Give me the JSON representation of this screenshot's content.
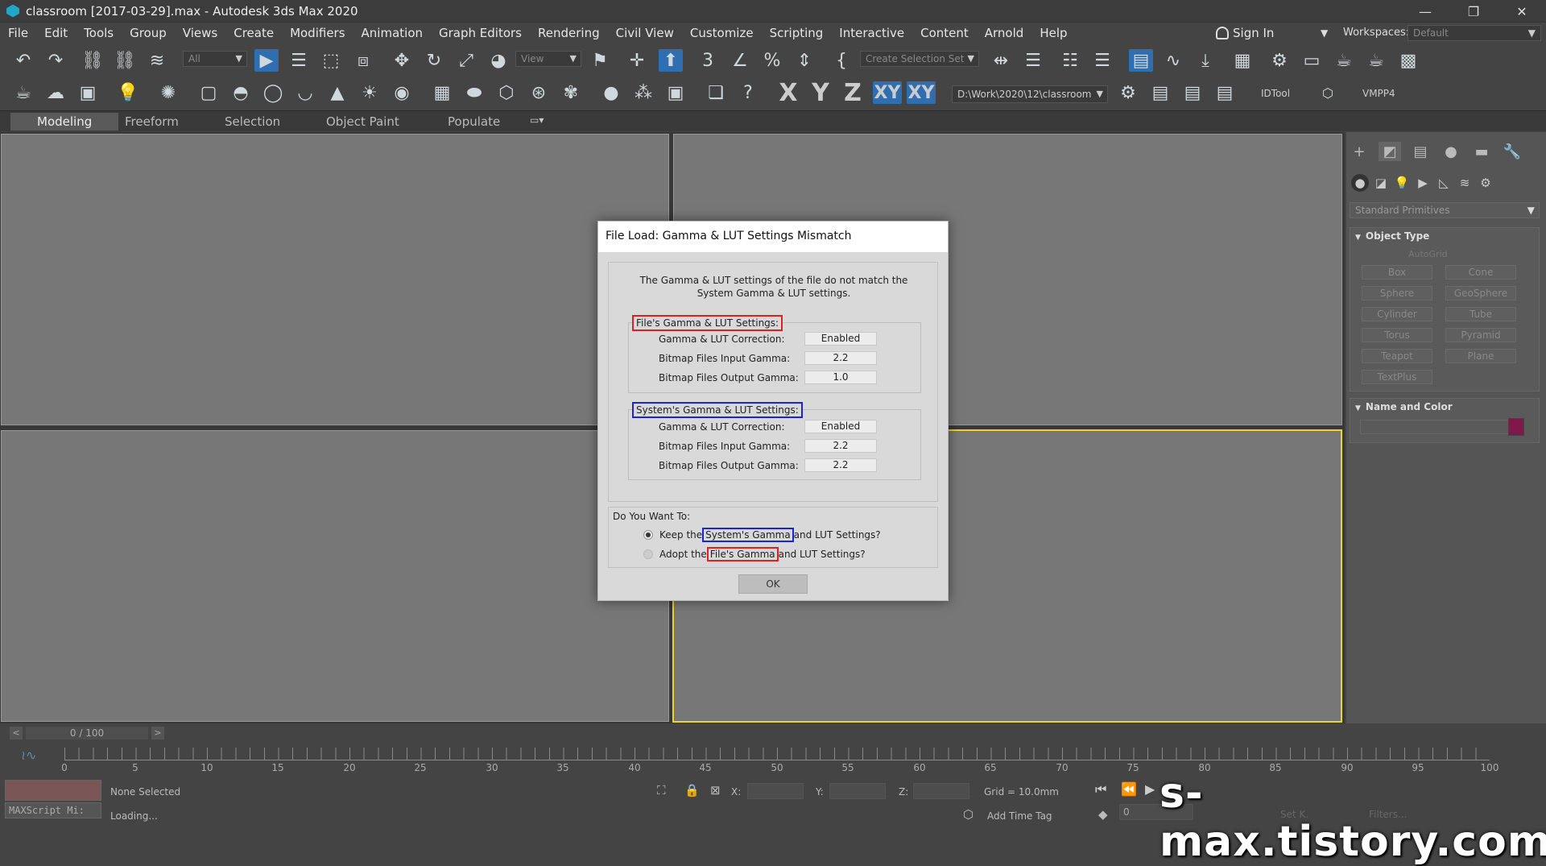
{
  "window": {
    "title": "classroom [2017-03-29].max - Autodesk 3ds Max 2020",
    "minimize": "—",
    "maximize": "❐",
    "close": "✕"
  },
  "menu": [
    "File",
    "Edit",
    "Tools",
    "Group",
    "Views",
    "Create",
    "Modifiers",
    "Animation",
    "Graph Editors",
    "Rendering",
    "Civil View",
    "Customize",
    "Scripting",
    "Interactive",
    "Content",
    "Arnold",
    "Help"
  ],
  "account": {
    "sign_in": "Sign In",
    "workspaces_label": "Workspaces:",
    "workspace": "Default"
  },
  "toolbar1": {
    "filter": "All",
    "ref_coord": "View",
    "selection_set": "Create Selection Set",
    "xy_label": "XY",
    "xy2_label": "XY"
  },
  "toolbar2": {
    "axis_x": "X",
    "axis_y": "Y",
    "axis_z": "Z",
    "project_path": "D:\\Work\\2020\\12\\classroom",
    "idtool": "IDTool",
    "vmpp4": "VMPP4"
  },
  "ribbon_tabs": [
    "Modeling",
    "Freeform",
    "Selection",
    "Object Paint",
    "Populate"
  ],
  "command_panel": {
    "category": "Standard Primitives",
    "object_type_title": "Object Type",
    "autogrid": "AutoGrid",
    "primitives": [
      "Box",
      "Cone",
      "Sphere",
      "GeoSphere",
      "Cylinder",
      "Tube",
      "Torus",
      "Pyramid",
      "Teapot",
      "Plane",
      "TextPlus"
    ],
    "name_color_title": "Name and Color",
    "object_color": "#7d1a4a"
  },
  "timeline": {
    "frame_display": "0 / 100",
    "prev": "<",
    "next": ">",
    "ticks": [
      "0",
      "5",
      "10",
      "15",
      "20",
      "25",
      "30",
      "35",
      "40",
      "45",
      "50",
      "55",
      "60",
      "65",
      "70",
      "75",
      "80",
      "85",
      "90",
      "95",
      "100"
    ]
  },
  "status": {
    "maxscript": "MAXScript Mi:",
    "selection": "None Selected",
    "loading": "Loading...",
    "x_label": "X:",
    "y_label": "Y:",
    "z_label": "Z:",
    "grid": "Grid = 10.0mm",
    "add_time_tag": "Add Time Tag",
    "current_frame": "0",
    "set_key": "Set K.",
    "filters": "Filters..."
  },
  "watermark": "s-max.tistory.com",
  "dialog": {
    "title": "File Load: Gamma & LUT Settings Mismatch",
    "message_line1": "The Gamma & LUT settings of the file do not match the",
    "message_line2": "System Gamma & LUT settings.",
    "file_group": {
      "title": "File's Gamma & LUT Settings:",
      "rows": [
        {
          "label": "Gamma & LUT Correction:",
          "value": "Enabled"
        },
        {
          "label": "Bitmap Files Input Gamma:",
          "value": "2.2"
        },
        {
          "label": "Bitmap Files Output Gamma:",
          "value": "1.0"
        }
      ]
    },
    "system_group": {
      "title": "System's Gamma & LUT Settings:",
      "rows": [
        {
          "label": "Gamma & LUT Correction:",
          "value": "Enabled"
        },
        {
          "label": "Bitmap Files Input Gamma:",
          "value": "2.2"
        },
        {
          "label": "Bitmap Files Output Gamma:",
          "value": "2.2"
        }
      ]
    },
    "question": "Do You Want To:",
    "option_keep": {
      "pre": "Keep the",
      "highlight": "System's Gamma",
      "post": "and LUT Settings?",
      "checked": true
    },
    "option_adopt": {
      "pre": "Adopt the",
      "highlight": "File's Gamma",
      "post": "and LUT Settings?",
      "checked": false
    },
    "ok": "OK",
    "highlight_red": "#e0201e",
    "highlight_blue": "#1e22d8"
  }
}
